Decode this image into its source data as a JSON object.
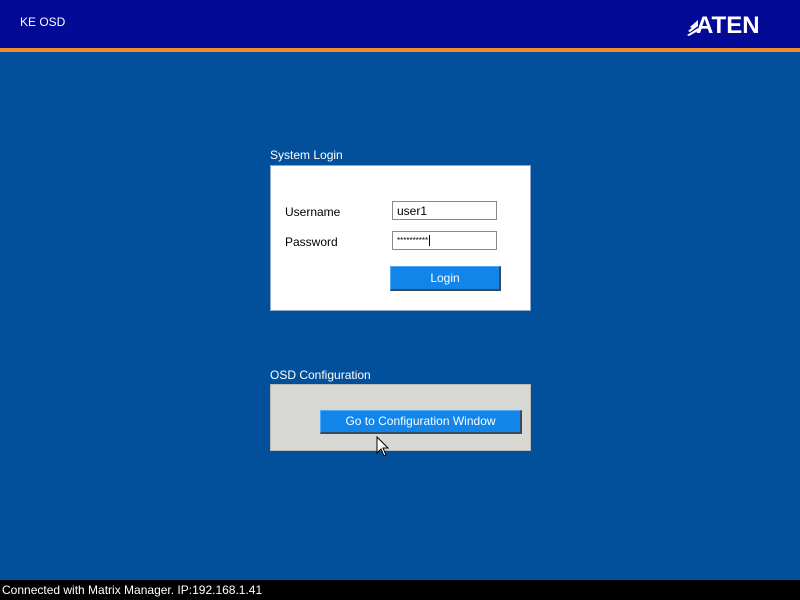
{
  "header": {
    "title": "KE OSD",
    "brand": "ATEN"
  },
  "login": {
    "section_title": "System Login",
    "username_label": "Username",
    "username_value": "user1",
    "password_label": "Password",
    "password_value": "**********",
    "login_button": "Login"
  },
  "osd_config": {
    "section_title": "OSD Configuration",
    "button": "Go to Configuration Window"
  },
  "status_bar": {
    "text": "Connected with Matrix Manager. IP:192.168.1.41"
  },
  "colors": {
    "background": "#02509b",
    "topbar": "#030a95",
    "accent": "#ef8d2a",
    "button": "#1185ea",
    "status_bar": "#000000"
  },
  "icons": {
    "logo": "aten-logo",
    "cursor": "mouse-pointer-icon"
  }
}
